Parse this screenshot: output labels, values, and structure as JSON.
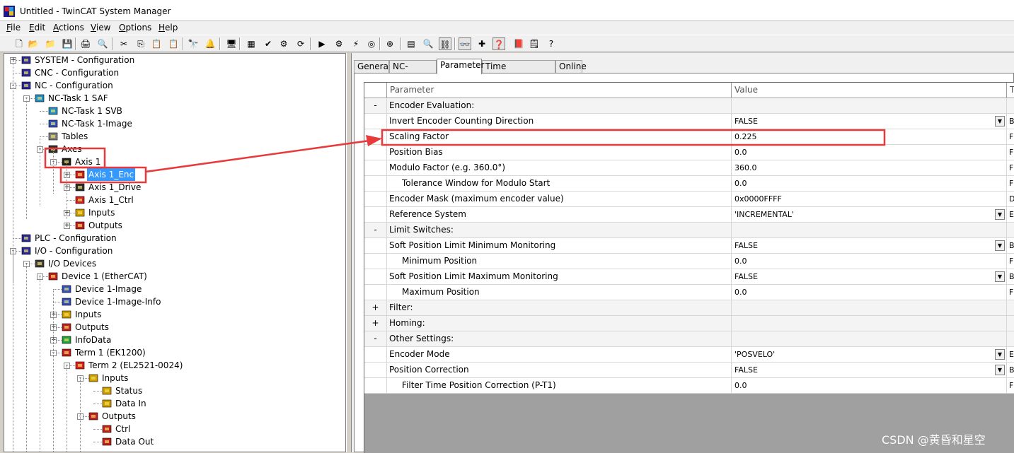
{
  "window": {
    "title": "Untitled - TwinCAT System Manager"
  },
  "menu": [
    {
      "label_u": "F",
      "label_rest": "ile"
    },
    {
      "label_u": "E",
      "label_rest": "dit"
    },
    {
      "label_u": "A",
      "label_rest": "ctions"
    },
    {
      "label_u": "V",
      "label_rest": "iew"
    },
    {
      "label_u": "O",
      "label_rest": "ptions"
    },
    {
      "label_u": "H",
      "label_rest": "elp"
    }
  ],
  "toolbar": {
    "icons": [
      "new-icon",
      "open-icon",
      "open-folder-icon",
      "save-icon",
      "print-icon",
      "print-preview-icon",
      "cut-icon",
      "copy-icon",
      "paste-icon",
      "paste-link-icon",
      "find-icon",
      "find-next-icon",
      "target-icon",
      "generate-mappings-icon",
      "check-config-icon",
      "activate-config-icon",
      "restart-icon",
      "set-run-mode-icon",
      "config-mode-icon",
      "free-run-icon",
      "toggle-online-icon",
      "scan-icon",
      "show-subitems-icon",
      "zoom-icon",
      "link-variable-icon",
      "goggles-icon",
      "add-child-icon",
      "help-context-icon",
      "book-icon",
      "notepad-icon",
      "help-icon"
    ]
  },
  "tree": {
    "items": [
      {
        "label": "SYSTEM - Configuration",
        "icon": "system-config-icon",
        "toggle": "+"
      },
      {
        "label": "CNC - Configuration",
        "icon": "cnc-config-icon",
        "toggle": ""
      },
      {
        "label": "NC - Configuration",
        "icon": "nc-config-icon",
        "toggle": "-"
      },
      {
        "label": "NC-Task 1 SAF",
        "icon": "nc-task-icon",
        "toggle": "-"
      },
      {
        "label": "NC-Task 1 SVB",
        "icon": "nc-task-icon",
        "toggle": ""
      },
      {
        "label": "NC-Task 1-Image",
        "icon": "image-icon",
        "toggle": ""
      },
      {
        "label": "Tables",
        "icon": "table-icon",
        "toggle": ""
      },
      {
        "label": "Axes",
        "icon": "axes-icon",
        "toggle": "-"
      },
      {
        "label": "Axis 1",
        "icon": "axis-icon",
        "toggle": "-"
      },
      {
        "label": "Axis 1_Enc",
        "icon": "encoder-icon",
        "toggle": "+",
        "selected": true
      },
      {
        "label": "Axis 1_Drive",
        "icon": "drive-icon",
        "toggle": "+"
      },
      {
        "label": "Axis 1_Ctrl",
        "icon": "controller-icon",
        "toggle": ""
      },
      {
        "label": "Inputs",
        "icon": "inputs-icon",
        "toggle": "+"
      },
      {
        "label": "Outputs",
        "icon": "outputs-icon",
        "toggle": "+"
      },
      {
        "label": "PLC - Configuration",
        "icon": "plc-config-icon",
        "toggle": ""
      },
      {
        "label": "I/O - Configuration",
        "icon": "io-config-icon",
        "toggle": "-"
      },
      {
        "label": "I/O Devices",
        "icon": "io-devices-icon",
        "toggle": "-"
      },
      {
        "label": "Device 1 (EtherCAT)",
        "icon": "ethercat-device-icon",
        "toggle": "-"
      },
      {
        "label": "Device 1-Image",
        "icon": "image-icon",
        "toggle": ""
      },
      {
        "label": "Device 1-Image-Info",
        "icon": "image-icon",
        "toggle": ""
      },
      {
        "label": "Inputs",
        "icon": "inputs-icon",
        "toggle": "+"
      },
      {
        "label": "Outputs",
        "icon": "outputs-icon",
        "toggle": "+"
      },
      {
        "label": "InfoData",
        "icon": "infodata-icon",
        "toggle": "+"
      },
      {
        "label": "Term 1 (EK1200)",
        "icon": "terminal-icon",
        "toggle": "-"
      },
      {
        "label": "Term 2 (EL2521-0024)",
        "icon": "terminal-red-icon",
        "toggle": "-"
      },
      {
        "label": "Inputs",
        "icon": "inputs-icon",
        "toggle": "-"
      },
      {
        "label": "Status",
        "icon": "input-var-icon",
        "toggle": ""
      },
      {
        "label": "Data In",
        "icon": "input-var-icon",
        "toggle": ""
      },
      {
        "label": "Outputs",
        "icon": "outputs-icon",
        "toggle": "-"
      },
      {
        "label": "Ctrl",
        "icon": "output-var-icon",
        "toggle": ""
      },
      {
        "label": "Data Out",
        "icon": "output-var-icon",
        "toggle": ""
      }
    ]
  },
  "tabs": [
    {
      "label": "General"
    },
    {
      "label": "NC-Encoder"
    },
    {
      "label": "Parameter",
      "active": true
    },
    {
      "label": "Time Compensation"
    },
    {
      "label": "Online"
    }
  ],
  "grid": {
    "headers": {
      "c0": "",
      "c1": "Parameter",
      "c2": "Value",
      "c3": "T"
    },
    "rows": [
      {
        "sign": "-",
        "param": "Encoder Evaluation:",
        "value": "",
        "type": "",
        "section": true
      },
      {
        "sign": "",
        "param": "Invert Encoder Counting Direction",
        "value": "FALSE",
        "type": "B",
        "dropdown": true
      },
      {
        "sign": "",
        "param": "Scaling Factor",
        "value": "0.225",
        "type": "F"
      },
      {
        "sign": "",
        "param": "Position Bias",
        "value": "0.0",
        "type": "F"
      },
      {
        "sign": "",
        "param": "Modulo Factor (e.g. 360.0°)",
        "value": "360.0",
        "type": "F"
      },
      {
        "sign": "",
        "param": "Tolerance Window for Modulo Start",
        "value": "0.0",
        "type": "F",
        "indent": true
      },
      {
        "sign": "",
        "param": "Encoder Mask (maximum encoder value)",
        "value": "0x0000FFFF",
        "type": "D"
      },
      {
        "sign": "",
        "param": "Reference System",
        "value": "'INCREMENTAL'",
        "type": "E",
        "dropdown": true
      },
      {
        "sign": "-",
        "param": "Limit Switches:",
        "value": "",
        "type": "",
        "section": true
      },
      {
        "sign": "",
        "param": "Soft Position Limit Minimum Monitoring",
        "value": "FALSE",
        "type": "B",
        "dropdown": true
      },
      {
        "sign": "",
        "param": "Minimum Position",
        "value": "0.0",
        "type": "F",
        "indent": true
      },
      {
        "sign": "",
        "param": "Soft Position Limit Maximum Monitoring",
        "value": "FALSE",
        "type": "B",
        "dropdown": true
      },
      {
        "sign": "",
        "param": "Maximum Position",
        "value": "0.0",
        "type": "F",
        "indent": true
      },
      {
        "sign": "+",
        "param": "Filter:",
        "value": "",
        "type": "",
        "section": true
      },
      {
        "sign": "+",
        "param": "Homing:",
        "value": "",
        "type": "",
        "section": true
      },
      {
        "sign": "-",
        "param": "Other Settings:",
        "value": "",
        "type": "",
        "section": true
      },
      {
        "sign": "",
        "param": "Encoder Mode",
        "value": "'POSVELO'",
        "type": "E",
        "dropdown": true
      },
      {
        "sign": "",
        "param": "Position Correction",
        "value": "FALSE",
        "type": "B",
        "dropdown": true
      },
      {
        "sign": "",
        "param": "Filter Time Position Correction (P-T1)",
        "value": "0.0",
        "type": "F",
        "indent": true
      }
    ]
  },
  "annotation_color": "#e83a3a",
  "watermark": "CSDN @黄昏和星空"
}
